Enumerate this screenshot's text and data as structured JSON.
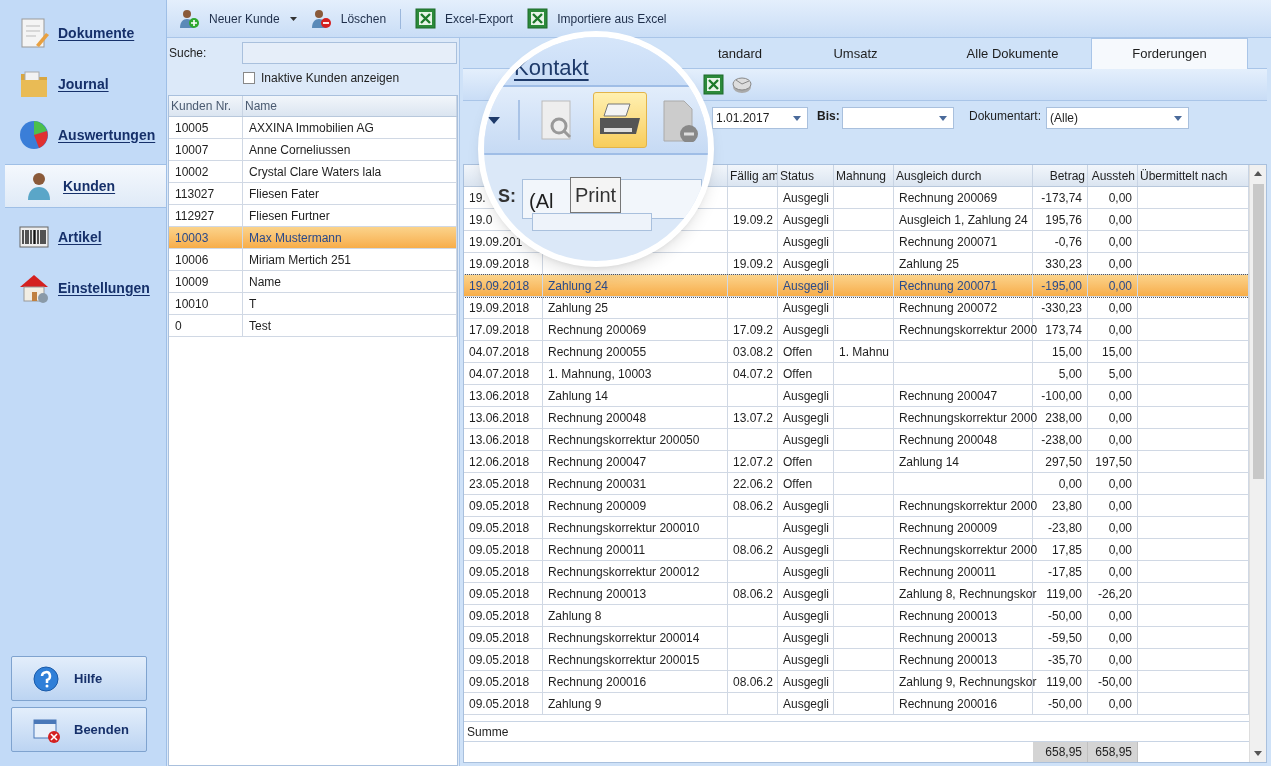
{
  "nav": {
    "items": [
      {
        "label": "Dokumente",
        "selected": false
      },
      {
        "label": "Journal",
        "selected": false
      },
      {
        "label": "Auswertungen",
        "selected": false
      },
      {
        "label": "Kunden",
        "selected": true
      },
      {
        "label": "Artikel",
        "selected": false
      },
      {
        "label": "Einstellungen",
        "selected": false
      }
    ],
    "buttons": [
      {
        "label": "Hilfe"
      },
      {
        "label": "Beenden"
      }
    ]
  },
  "toolbar": {
    "items": [
      {
        "label": "Neuer Kunde",
        "dropdown": true
      },
      {
        "label": "Löschen",
        "dropdown": false
      },
      {
        "label": "Excel-Export",
        "dropdown": false
      },
      {
        "label": "Importiere aus Excel",
        "dropdown": false
      }
    ]
  },
  "customers": {
    "search_label": "Suche:",
    "inactive": {
      "label": "Inaktive Kunden anzeigen",
      "checked": false
    },
    "columns": [
      "Kunden Nr.",
      "Name"
    ],
    "rows": [
      {
        "cells": [
          "10005",
          "AXXINA Immobilien AG"
        ],
        "selected": false
      },
      {
        "cells": [
          "10007",
          "Anne Corneliussen"
        ],
        "selected": false
      },
      {
        "cells": [
          "10002",
          "Crystal Clare Waters lala"
        ],
        "selected": false
      },
      {
        "cells": [
          "113027",
          "Fliesen Fater"
        ],
        "selected": false
      },
      {
        "cells": [
          "112927",
          "Fliesen Furtner"
        ],
        "selected": false
      },
      {
        "cells": [
          "10003",
          "Max Mustermann"
        ],
        "selected": true
      },
      {
        "cells": [
          "10006",
          "Miriam Mertich 251"
        ],
        "selected": false
      },
      {
        "cells": [
          "10009",
          "Name"
        ],
        "selected": false
      },
      {
        "cells": [
          "10010",
          "T"
        ],
        "selected": false
      },
      {
        "cells": [
          "0",
          "Test"
        ],
        "selected": false
      }
    ]
  },
  "details": {
    "tabs": [
      {
        "label": "tandard",
        "selected": false
      },
      {
        "label": "Umsatz",
        "selected": false
      },
      {
        "label": "Alle Dokumente",
        "selected": false
      },
      {
        "label": "Forderungen",
        "selected": true
      }
    ],
    "filter": {
      "from_value": "1.01.2017",
      "to_label": "Bis:",
      "doctype_label": "Dokumentart:",
      "doctype_value": "(Alle)"
    },
    "table": {
      "columns": [
        "",
        "",
        "Fällig am",
        "Status",
        "Mahnung",
        "Ausgleich durch",
        "Betrag",
        "Aussteh",
        "Übermittelt nach"
      ],
      "rows": [
        {
          "cells": [
            "19.",
            null,
            null,
            "Ausgegli",
            null,
            "Rechnung 200069",
            "-173,74",
            "0,00",
            null
          ],
          "selected": false
        },
        {
          "cells": [
            "19.0",
            null,
            "19.09.2",
            "Ausgegli",
            null,
            "Ausgleich 1, Zahlung 24",
            "195,76",
            "0,00",
            null
          ],
          "selected": false
        },
        {
          "cells": [
            "19.09.201",
            null,
            null,
            "Ausgegli",
            null,
            "Rechnung 200071",
            "-0,76",
            "0,00",
            null
          ],
          "selected": false
        },
        {
          "cells": [
            "19.09.2018",
            null,
            "19.09.2",
            "Ausgegli",
            null,
            "Zahlung 25",
            "330,23",
            "0,00",
            null
          ],
          "selected": false
        },
        {
          "cells": [
            "19.09.2018",
            "Zahlung 24",
            null,
            "Ausgegli",
            null,
            "Rechnung 200071",
            "-195,00",
            "0,00",
            null
          ],
          "selected": true
        },
        {
          "cells": [
            "19.09.2018",
            "Zahlung 25",
            null,
            "Ausgegli",
            null,
            "Rechnung 200072",
            "-330,23",
            "0,00",
            null
          ],
          "selected": false
        },
        {
          "cells": [
            "17.09.2018",
            "Rechnung 200069",
            "17.09.2",
            "Ausgegli",
            null,
            "Rechnungskorrektur 2000",
            "173,74",
            "0,00",
            null
          ],
          "selected": false
        },
        {
          "cells": [
            "04.07.2018",
            "Rechnung 200055",
            "03.08.2",
            "Offen",
            "1. Mahnu",
            null,
            "15,00",
            "15,00",
            null
          ],
          "selected": false
        },
        {
          "cells": [
            "04.07.2018",
            "1. Mahnung, 10003",
            "04.07.2",
            "Offen",
            null,
            null,
            "5,00",
            "5,00",
            null
          ],
          "selected": false
        },
        {
          "cells": [
            "13.06.2018",
            "Zahlung 14",
            null,
            "Ausgegli",
            null,
            "Rechnung 200047",
            "-100,00",
            "0,00",
            null
          ],
          "selected": false
        },
        {
          "cells": [
            "13.06.2018",
            "Rechnung 200048",
            "13.07.2",
            "Ausgegli",
            null,
            "Rechnungskorrektur 2000",
            "238,00",
            "0,00",
            null
          ],
          "selected": false
        },
        {
          "cells": [
            "13.06.2018",
            "Rechnungskorrektur 200050",
            null,
            "Ausgegli",
            null,
            "Rechnung 200048",
            "-238,00",
            "0,00",
            null
          ],
          "selected": false
        },
        {
          "cells": [
            "12.06.2018",
            "Rechnung 200047",
            "12.07.2",
            "Offen",
            null,
            "Zahlung 14",
            "297,50",
            "197,50",
            null
          ],
          "selected": false
        },
        {
          "cells": [
            "23.05.2018",
            "Rechnung 200031",
            "22.06.2",
            "Offen",
            null,
            null,
            "0,00",
            "0,00",
            null
          ],
          "selected": false
        },
        {
          "cells": [
            "09.05.2018",
            "Rechnung 200009",
            "08.06.2",
            "Ausgegli",
            null,
            "Rechnungskorrektur 2000",
            "23,80",
            "0,00",
            null
          ],
          "selected": false
        },
        {
          "cells": [
            "09.05.2018",
            "Rechnungskorrektur 200010",
            null,
            "Ausgegli",
            null,
            "Rechnung 200009",
            "-23,80",
            "0,00",
            null
          ],
          "selected": false
        },
        {
          "cells": [
            "09.05.2018",
            "Rechnung 200011",
            "08.06.2",
            "Ausgegli",
            null,
            "Rechnungskorrektur 2000",
            "17,85",
            "0,00",
            null
          ],
          "selected": false
        },
        {
          "cells": [
            "09.05.2018",
            "Rechnungskorrektur 200012",
            null,
            "Ausgegli",
            null,
            "Rechnung 200011",
            "-17,85",
            "0,00",
            null
          ],
          "selected": false
        },
        {
          "cells": [
            "09.05.2018",
            "Rechnung 200013",
            "08.06.2",
            "Ausgegli",
            null,
            "Zahlung 8, Rechnungskor",
            "119,00",
            "-26,20",
            null
          ],
          "selected": false
        },
        {
          "cells": [
            "09.05.2018",
            "Zahlung 8",
            null,
            "Ausgegli",
            null,
            "Rechnung 200013",
            "-50,00",
            "0,00",
            null
          ],
          "selected": false
        },
        {
          "cells": [
            "09.05.2018",
            "Rechnungskorrektur 200014",
            null,
            "Ausgegli",
            null,
            "Rechnung 200013",
            "-59,50",
            "0,00",
            null
          ],
          "selected": false
        },
        {
          "cells": [
            "09.05.2018",
            "Rechnungskorrektur 200015",
            null,
            "Ausgegli",
            null,
            "Rechnung 200013",
            "-35,70",
            "0,00",
            null
          ],
          "selected": false
        },
        {
          "cells": [
            "09.05.2018",
            "Rechnung 200016",
            "08.06.2",
            "Ausgegli",
            null,
            "Zahlung 9, Rechnungskor",
            "119,00",
            "-50,00",
            null
          ],
          "selected": false
        },
        {
          "cells": [
            "09.05.2018",
            "Zahlung 9",
            null,
            "Ausgegli",
            null,
            "Rechnung 200016",
            "-50,00",
            "0,00",
            null
          ],
          "selected": false
        }
      ],
      "summary_label": "Summe",
      "totals": [
        "658,95",
        "658,95"
      ]
    }
  },
  "magnifier": {
    "tab": "Kontakt",
    "tools": [
      {
        "kind": "preview",
        "hovered": false
      },
      {
        "kind": "print",
        "hovered": true
      },
      {
        "kind": "remove",
        "hovered": false
      }
    ],
    "field_label": "S:",
    "field_value": "(Al",
    "tooltip": "Print"
  }
}
